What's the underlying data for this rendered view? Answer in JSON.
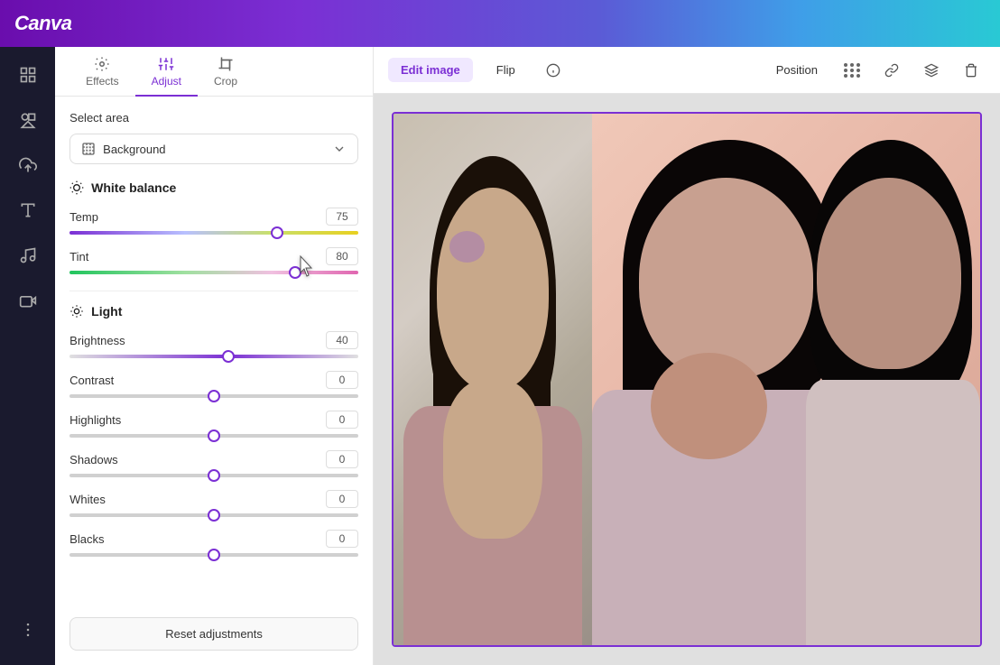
{
  "app": {
    "logo": "Canva"
  },
  "topbar": {},
  "icon_bar": {
    "items": [
      {
        "name": "grid-icon",
        "label": "Templates"
      },
      {
        "name": "elements-icon",
        "label": "Elements"
      },
      {
        "name": "upload-icon",
        "label": "Uploads"
      },
      {
        "name": "text-icon",
        "label": "Text"
      },
      {
        "name": "music-icon",
        "label": "Audio"
      },
      {
        "name": "video-icon",
        "label": "Video"
      },
      {
        "name": "more-icon",
        "label": "More"
      }
    ]
  },
  "sidebar": {
    "tabs": [
      {
        "id": "effects",
        "label": "Effects"
      },
      {
        "id": "adjust",
        "label": "Adjust"
      },
      {
        "id": "crop",
        "label": "Crop"
      }
    ],
    "active_tab": "adjust",
    "select_area": {
      "label": "Select area",
      "value": "Background",
      "placeholder": "Background"
    },
    "white_balance": {
      "title": "White balance",
      "sliders": [
        {
          "id": "temp",
          "label": "Temp",
          "value": 75,
          "position_pct": 72
        },
        {
          "id": "tint",
          "label": "Tint",
          "value": 80,
          "position_pct": 78
        }
      ]
    },
    "light": {
      "title": "Light",
      "sliders": [
        {
          "id": "brightness",
          "label": "Brightness",
          "value": 40,
          "position_pct": 55
        },
        {
          "id": "contrast",
          "label": "Contrast",
          "value": 0,
          "position_pct": 50
        },
        {
          "id": "highlights",
          "label": "Highlights",
          "value": 0,
          "position_pct": 50
        },
        {
          "id": "shadows",
          "label": "Shadows",
          "value": 0,
          "position_pct": 50
        },
        {
          "id": "whites",
          "label": "Whites",
          "value": 0,
          "position_pct": 50
        },
        {
          "id": "blacks",
          "label": "Blacks",
          "value": 0,
          "position_pct": 50
        }
      ]
    },
    "reset_button": "Reset adjustments"
  },
  "canvas_toolbar": {
    "edit_image": "Edit image",
    "flip": "Flip",
    "info_icon": "info",
    "position": "Position",
    "position_dots_icon": "position-grid",
    "link_icon": "link",
    "layers_icon": "layers",
    "trash_icon": "trash"
  }
}
